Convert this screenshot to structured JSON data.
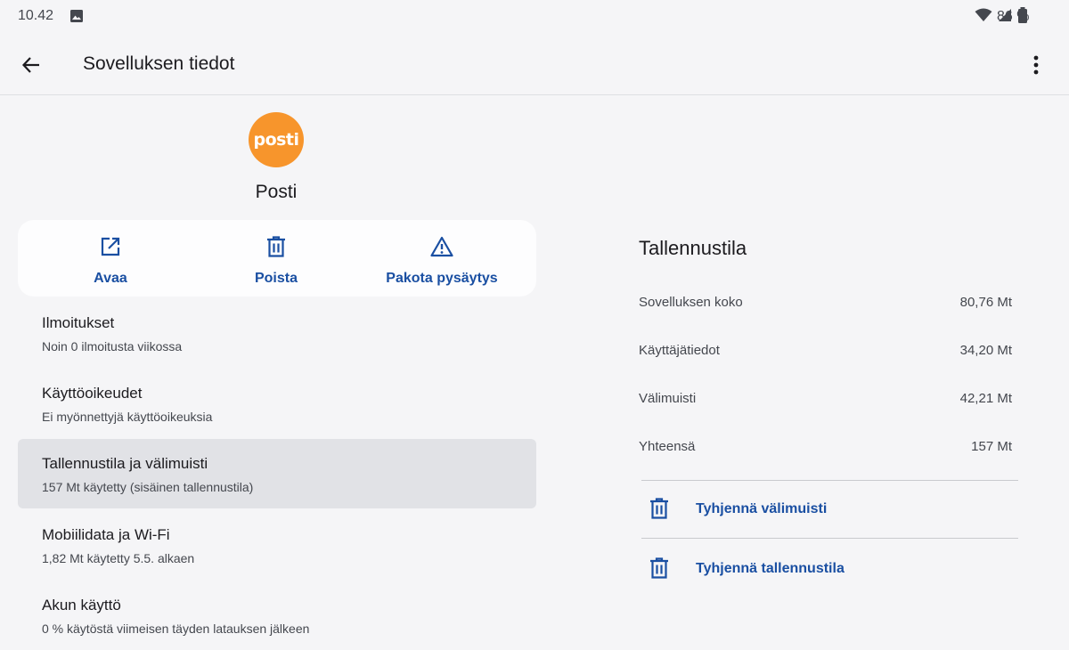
{
  "status_bar": {
    "time": "10.42",
    "battery": "86 %",
    "icons": [
      "image-icon",
      "wifi-icon",
      "signal-icon",
      "battery-icon"
    ]
  },
  "header": {
    "title": "Sovelluksen tiedot",
    "back_icon": "arrow-back-icon",
    "more_icon": "more-vert-icon"
  },
  "app": {
    "name": "Posti",
    "icon_text": "posti",
    "icon_color": "#f7952c"
  },
  "actions": [
    {
      "label": "Avaa",
      "icon": "open-external-icon"
    },
    {
      "label": "Poista",
      "icon": "trash-icon"
    },
    {
      "label": "Pakota pysäytys",
      "icon": "warning-icon"
    }
  ],
  "list": [
    {
      "title": "Ilmoitukset",
      "subtitle": "Noin 0 ilmoitusta viikossa"
    },
    {
      "title": "Käyttöoikeudet",
      "subtitle": "Ei myönnettyjä käyttöoikeuksia"
    },
    {
      "title": "Tallennustila ja välimuisti",
      "subtitle": "157 Mt käytetty (sisäinen tallennustila)",
      "selected": true
    },
    {
      "title": "Mobiilidata ja Wi-Fi",
      "subtitle": "1,82 Mt käytetty 5.5. alkaen"
    },
    {
      "title": "Akun käyttö",
      "subtitle": "0 % käytöstä viimeisen täyden latauksen jälkeen"
    }
  ],
  "storage": {
    "title": "Tallennustila",
    "rows": [
      {
        "label": "Sovelluksen koko",
        "value": "80,76 Mt"
      },
      {
        "label": "Käyttäjätiedot",
        "value": "34,20 Mt"
      },
      {
        "label": "Välimuisti",
        "value": "42,21 Mt"
      },
      {
        "label": "Yhteensä",
        "value": "157 Mt"
      }
    ],
    "buttons": [
      {
        "label": "Tyhjennä välimuisti",
        "icon": "trash-icon"
      },
      {
        "label": "Tyhjennä tallennustila",
        "icon": "trash-icon"
      }
    ]
  },
  "colors": {
    "accent": "#1a4fa2",
    "background": "#f5f5f7",
    "selected": "#e1e2e6"
  }
}
